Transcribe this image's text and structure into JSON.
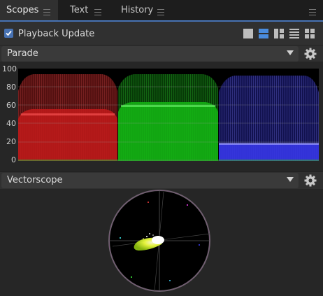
{
  "tabs": [
    {
      "label": "Scopes",
      "active": true
    },
    {
      "label": "Text",
      "active": false
    },
    {
      "label": "History",
      "active": false
    }
  ],
  "playback": {
    "label": "Playback Update",
    "checked": true
  },
  "layout_buttons": [
    "single-view-icon",
    "two-rows-icon",
    "three-panes-icon",
    "list-rows-icon",
    "quad-grid-icon"
  ],
  "parade": {
    "label": "Parade",
    "y_ticks": [
      "100",
      "80",
      "60",
      "40",
      "20",
      "0"
    ],
    "channel_colors": [
      "#ff2a2a",
      "#1dff1d",
      "#4a4aff"
    ]
  },
  "vectorscope": {
    "label": "Vectorscope"
  },
  "colors": {
    "accent": "#4772b3",
    "panel": "#303030",
    "background": "#232323"
  }
}
